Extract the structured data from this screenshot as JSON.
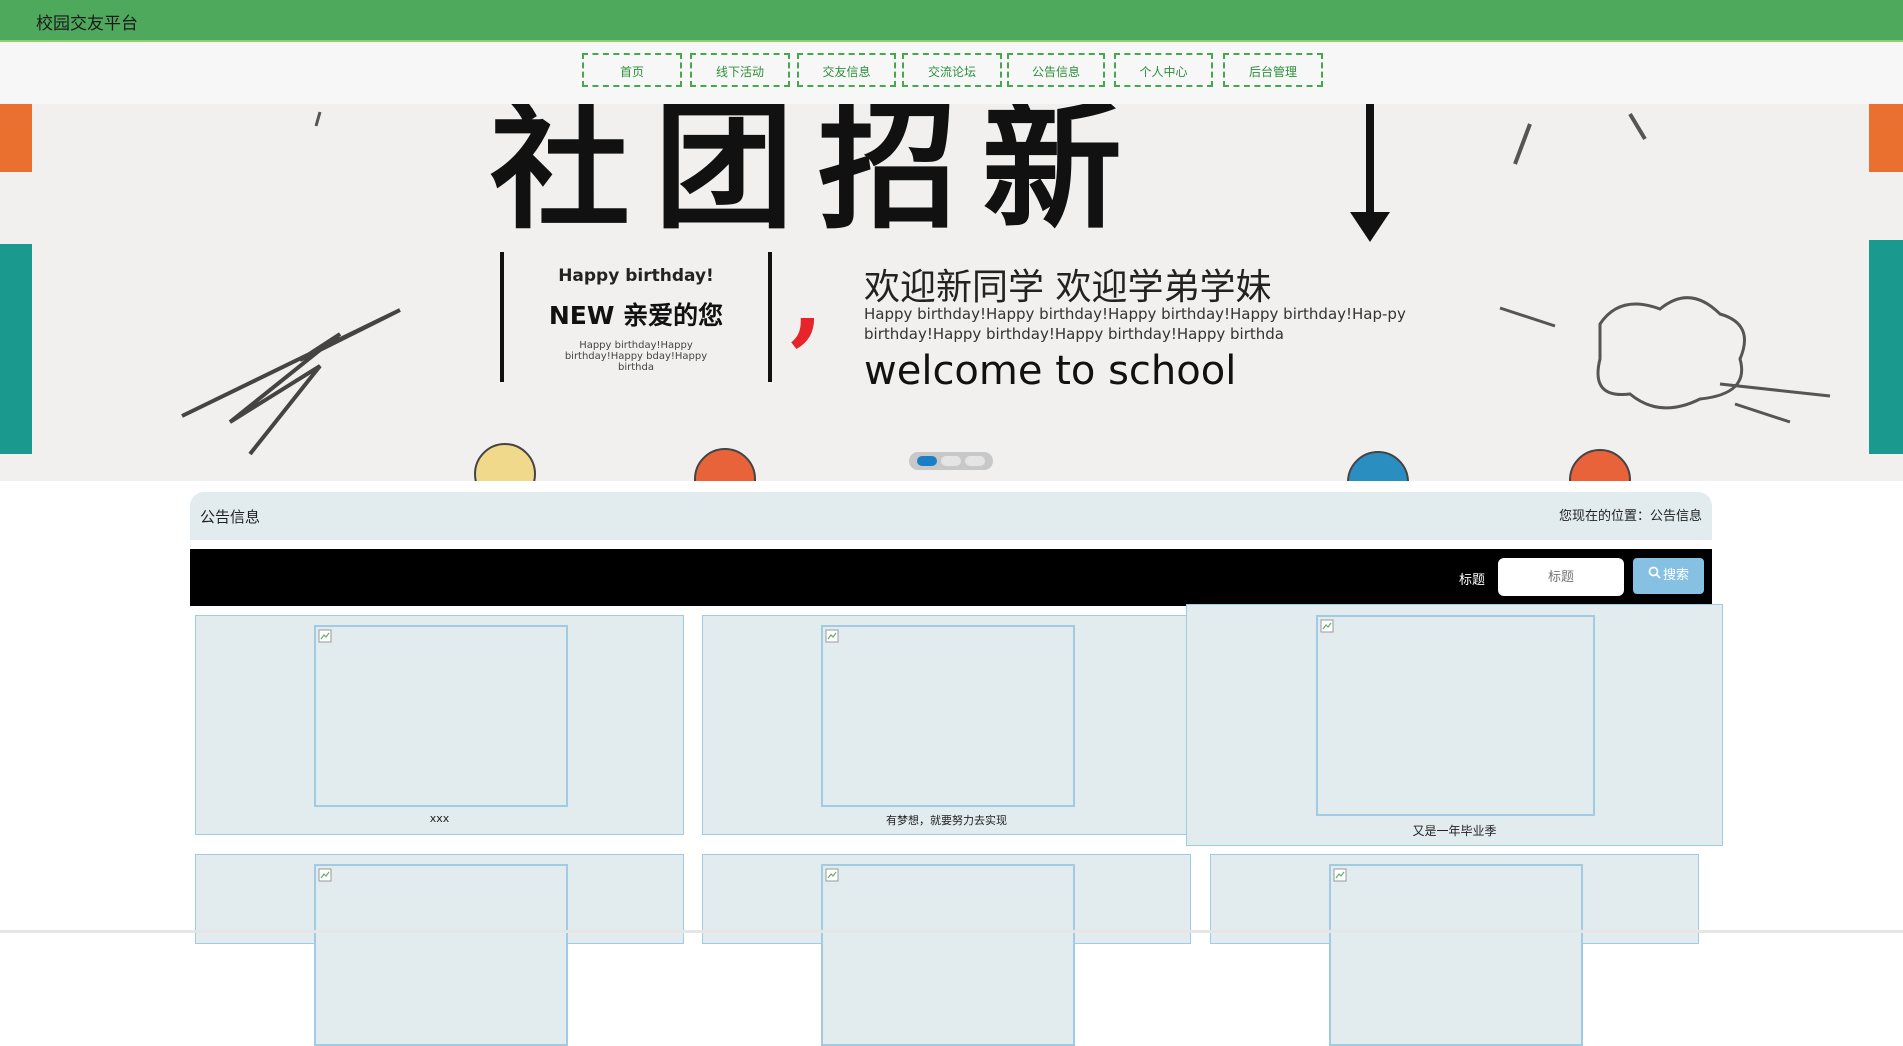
{
  "site": {
    "title": "校园交友平台"
  },
  "nav": {
    "items": [
      {
        "label": "首页"
      },
      {
        "label": "线下活动"
      },
      {
        "label": "交友信息"
      },
      {
        "label": "交流论坛"
      },
      {
        "label": "公告信息"
      },
      {
        "label": "个人中心"
      },
      {
        "label": "后台管理"
      }
    ]
  },
  "banner": {
    "headline_chars": "社团招新",
    "badge_line1": "Happy birthday!",
    "badge_line2": "NEW 亲爱的您",
    "badge_line3": "Happy birthday!Happy birthday!Happy bday!Happy birthda",
    "welcome_cn": "欢迎新同学 欢迎学弟学妹",
    "birthday_text": "Happy birthday!Happy birthday!Happy birthday!Happy birthday!Hap-py birthday!Happy birthday!Happy birthday!Happy birthda",
    "welcome_en": "welcome to school",
    "slides": 3,
    "active_slide": 1
  },
  "breadcrumb": {
    "section_title": "公告信息",
    "location_text": "您现在的位置：公告信息"
  },
  "search": {
    "label": "标题",
    "placeholder": "标题",
    "button_label": "搜索",
    "button_icon": "search-icon"
  },
  "notices": [
    {
      "caption": "xxx"
    },
    {
      "caption": "有梦想，就要努力去实现"
    },
    {
      "caption": "又是一年毕业季"
    },
    {
      "caption": ""
    },
    {
      "caption": ""
    },
    {
      "caption": ""
    }
  ],
  "colors": {
    "header_bg": "#4fa95d",
    "nav_border": "#45a84f",
    "panel_bg": "#e2ecef",
    "card_border": "#9fcbe3",
    "search_button": "#86c0e3",
    "slider_active": "#1a7fc4"
  }
}
